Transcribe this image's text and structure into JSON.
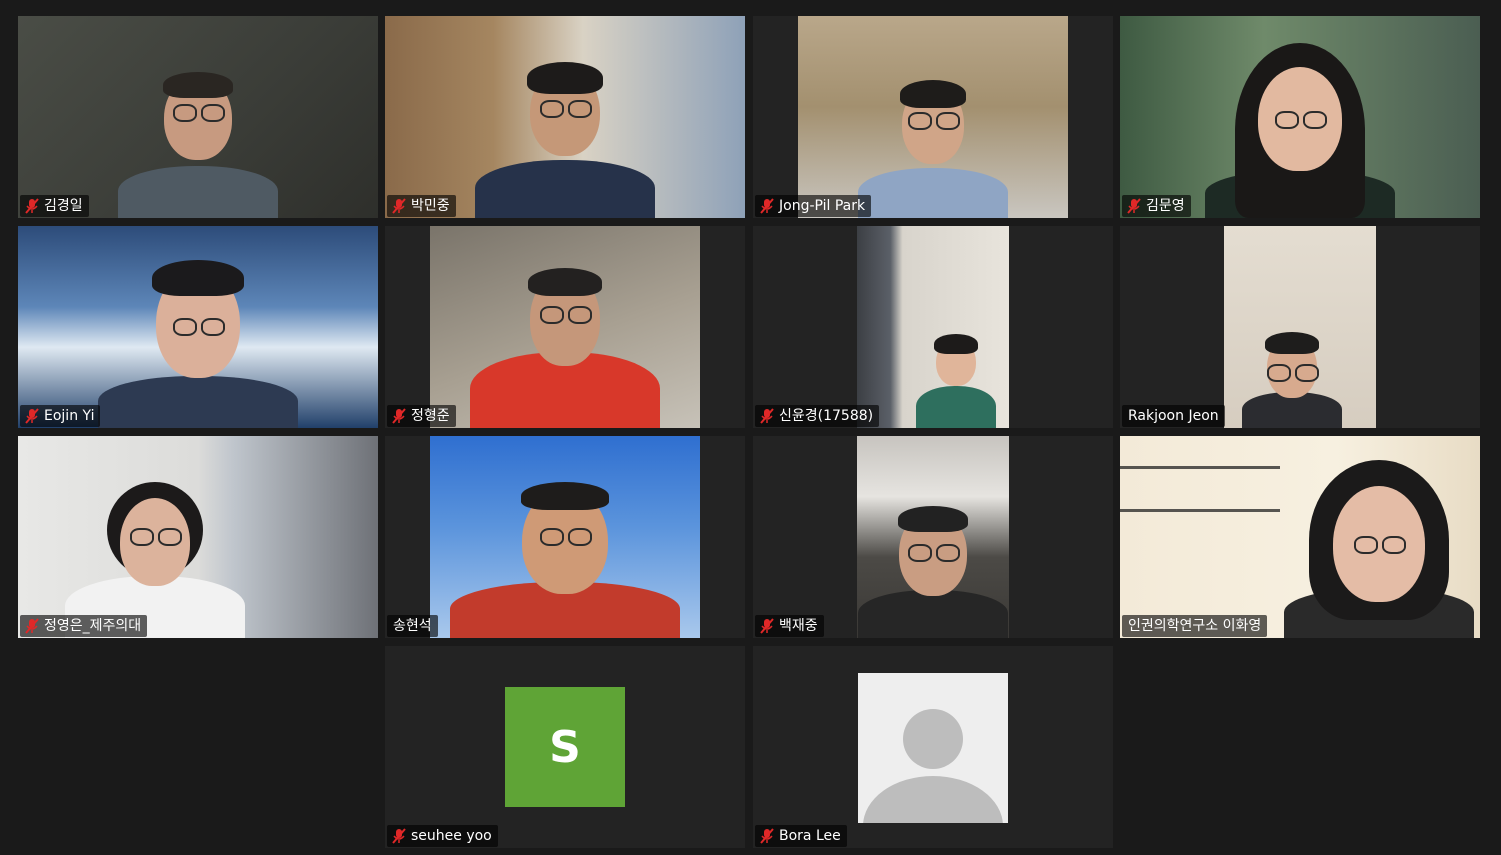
{
  "participants": [
    {
      "name": "김경일",
      "muted": true,
      "video": "on"
    },
    {
      "name": "박민중",
      "muted": true,
      "video": "on"
    },
    {
      "name": "Jong-Pil Park",
      "muted": true,
      "video": "on"
    },
    {
      "name": "김문영",
      "muted": true,
      "video": "on"
    },
    {
      "name": "Eojin Yi",
      "muted": true,
      "video": "on"
    },
    {
      "name": "정형준",
      "muted": true,
      "video": "on"
    },
    {
      "name": "신윤경(17588)",
      "muted": true,
      "video": "on"
    },
    {
      "name": "Rakjoon Jeon",
      "muted": false,
      "video": "on"
    },
    {
      "name": "정영은_제주의대",
      "muted": true,
      "video": "on"
    },
    {
      "name": "송현석",
      "muted": false,
      "video": "on",
      "active_speaker": true
    },
    {
      "name": "백재중",
      "muted": true,
      "video": "on"
    },
    {
      "name": "인권의학연구소 이화영",
      "muted": false,
      "video": "on"
    },
    {
      "name": "seuhee yoo",
      "muted": true,
      "video": "off",
      "avatar_initial": "S",
      "avatar_color": "#5fa436"
    },
    {
      "name": "Bora Lee",
      "muted": true,
      "video": "off",
      "avatar": "generic-person-icon"
    }
  ],
  "colors": {
    "background": "#1a1a1a",
    "tile": "#232323",
    "active_speaker_border": "#d3e04a",
    "muted_icon": "#e02828"
  }
}
